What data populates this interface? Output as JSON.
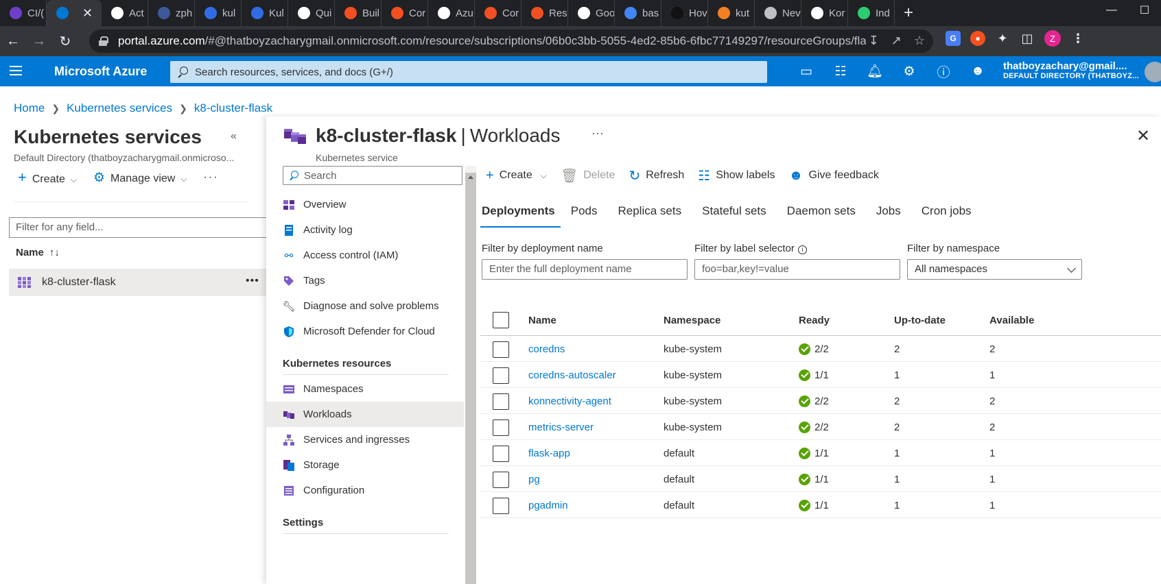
{
  "browser": {
    "tabs": [
      {
        "label": "CI/(",
        "color": "#6e40c9"
      },
      {
        "label": "",
        "color": "#0078d4",
        "active": true
      },
      {
        "label": "Act",
        "color": "#ffffff"
      },
      {
        "label": "zph",
        "color": "#3b5998"
      },
      {
        "label": "kul",
        "color": "#326ce5"
      },
      {
        "label": "Kul",
        "color": "#326ce5"
      },
      {
        "label": "Qui",
        "color": "#ffffff"
      },
      {
        "label": "Buil",
        "color": "#f25022"
      },
      {
        "label": "Cor",
        "color": "#f25022"
      },
      {
        "label": "Azu",
        "color": "#ffffff"
      },
      {
        "label": "Cor",
        "color": "#f25022"
      },
      {
        "label": "Res",
        "color": "#f25022"
      },
      {
        "label": "Goo",
        "color": "#ffffff"
      },
      {
        "label": "bas",
        "color": "#4285f4"
      },
      {
        "label": "Hov",
        "color": "#111111"
      },
      {
        "label": "kut",
        "color": "#f48024"
      },
      {
        "label": "Nev",
        "color": "#bdc1c6"
      },
      {
        "label": "Kor",
        "color": "#ffffff"
      },
      {
        "label": "Ind",
        "color": "#2ecc71"
      }
    ],
    "url_host": "portal.azure.com",
    "url_path": "/#@thatboyzacharygmail.onmicrosoft.com/resource/subscriptions/06b0c3bb-5055-4ed2-85b6-6fbc77149297/resourceGroups/flask...",
    "profile_initial": "Z"
  },
  "azure": {
    "brand": "Microsoft Azure",
    "search_placeholder": "Search resources, services, and docs (G+/)",
    "user_name": "thatboyzachary@gmail....",
    "user_dir": "DEFAULT DIRECTORY (THATBOYZ..."
  },
  "breadcrumb": [
    "Home",
    "Kubernetes services",
    "k8-cluster-flask"
  ],
  "left_blade": {
    "title": "Kubernetes services",
    "subtitle": "Default Directory (thatboyzacharygmail.onmicroso...",
    "create": "Create",
    "manage_view": "Manage view",
    "filter_placeholder": "Filter for any field...",
    "name_header": "Name",
    "sort_indicator": "↑↓",
    "item": "k8-cluster-flask"
  },
  "blade": {
    "resource": "k8-cluster-flask",
    "section": "Workloads",
    "subtitle": "Kubernetes service",
    "search_placeholder": "Search",
    "menu": [
      {
        "label": "Overview",
        "icon": "overview-icon"
      },
      {
        "label": "Activity log",
        "icon": "activity-log-icon"
      },
      {
        "label": "Access control (IAM)",
        "icon": "iam-icon"
      },
      {
        "label": "Tags",
        "icon": "tag-icon"
      },
      {
        "label": "Diagnose and solve problems",
        "icon": "wrench-icon"
      },
      {
        "label": "Microsoft Defender for Cloud",
        "icon": "shield-icon"
      }
    ],
    "k8s_section": "Kubernetes resources",
    "k8s_menu": [
      {
        "label": "Namespaces",
        "icon": "namespaces-icon"
      },
      {
        "label": "Workloads",
        "icon": "workloads-icon"
      },
      {
        "label": "Services and ingresses",
        "icon": "services-icon"
      },
      {
        "label": "Storage",
        "icon": "storage-icon"
      },
      {
        "label": "Configuration",
        "icon": "configuration-icon"
      }
    ],
    "settings_section": "Settings"
  },
  "commands": {
    "create": "Create",
    "delete": "Delete",
    "refresh": "Refresh",
    "show_labels": "Show labels",
    "feedback": "Give feedback"
  },
  "tabs": [
    "Deployments",
    "Pods",
    "Replica sets",
    "Stateful sets",
    "Daemon sets",
    "Jobs",
    "Cron jobs"
  ],
  "filters": {
    "name_label": "Filter by deployment name",
    "name_placeholder": "Enter the full deployment name",
    "label_label": "Filter by label selector",
    "label_placeholder": "foo=bar,key!=value",
    "ns_label": "Filter by namespace",
    "ns_value": "All namespaces"
  },
  "table": {
    "headers": {
      "name": "Name",
      "namespace": "Namespace",
      "ready": "Ready",
      "uptodate": "Up-to-date",
      "available": "Available"
    },
    "rows": [
      {
        "name": "coredns",
        "namespace": "kube-system",
        "ready": "2/2",
        "uptodate": "2",
        "available": "2"
      },
      {
        "name": "coredns-autoscaler",
        "namespace": "kube-system",
        "ready": "1/1",
        "uptodate": "1",
        "available": "1"
      },
      {
        "name": "konnectivity-agent",
        "namespace": "kube-system",
        "ready": "2/2",
        "uptodate": "2",
        "available": "2"
      },
      {
        "name": "metrics-server",
        "namespace": "kube-system",
        "ready": "2/2",
        "uptodate": "2",
        "available": "2"
      },
      {
        "name": "flask-app",
        "namespace": "default",
        "ready": "1/1",
        "uptodate": "1",
        "available": "1"
      },
      {
        "name": "pg",
        "namespace": "default",
        "ready": "1/1",
        "uptodate": "1",
        "available": "1"
      },
      {
        "name": "pgadmin",
        "namespace": "default",
        "ready": "1/1",
        "uptodate": "1",
        "available": "1"
      }
    ]
  },
  "colors": {
    "azure_blue": "#0078d4",
    "ok_green": "#57a300"
  }
}
